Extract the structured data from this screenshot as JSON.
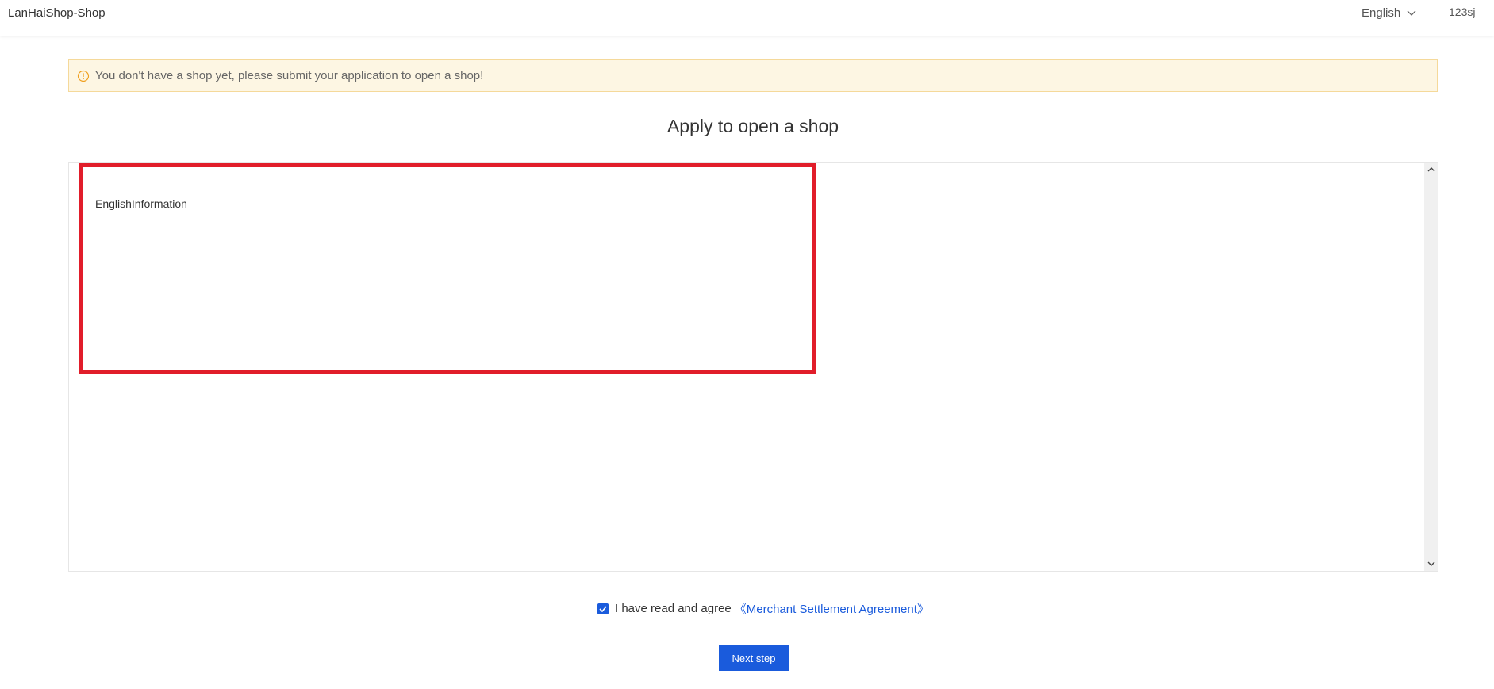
{
  "header": {
    "brand": "LanHaiShop-Shop",
    "language": "English",
    "username": "123sj"
  },
  "alert": {
    "icon": "info-circle-icon",
    "text": "You don't have a shop yet, please submit your application to open a shop!",
    "color": "#f0a020"
  },
  "page": {
    "title": "Apply to open a shop"
  },
  "agreement": {
    "content_text": "EnglishInformation"
  },
  "consent": {
    "checked": true,
    "label": "I have read and agree",
    "link": "《Merchant Settlement Agreement》"
  },
  "actions": {
    "next_label": "Next step"
  },
  "colors": {
    "primary": "#1a5bdc",
    "highlight": "#e11d2a",
    "alert_bg": "#fdf6e3"
  }
}
